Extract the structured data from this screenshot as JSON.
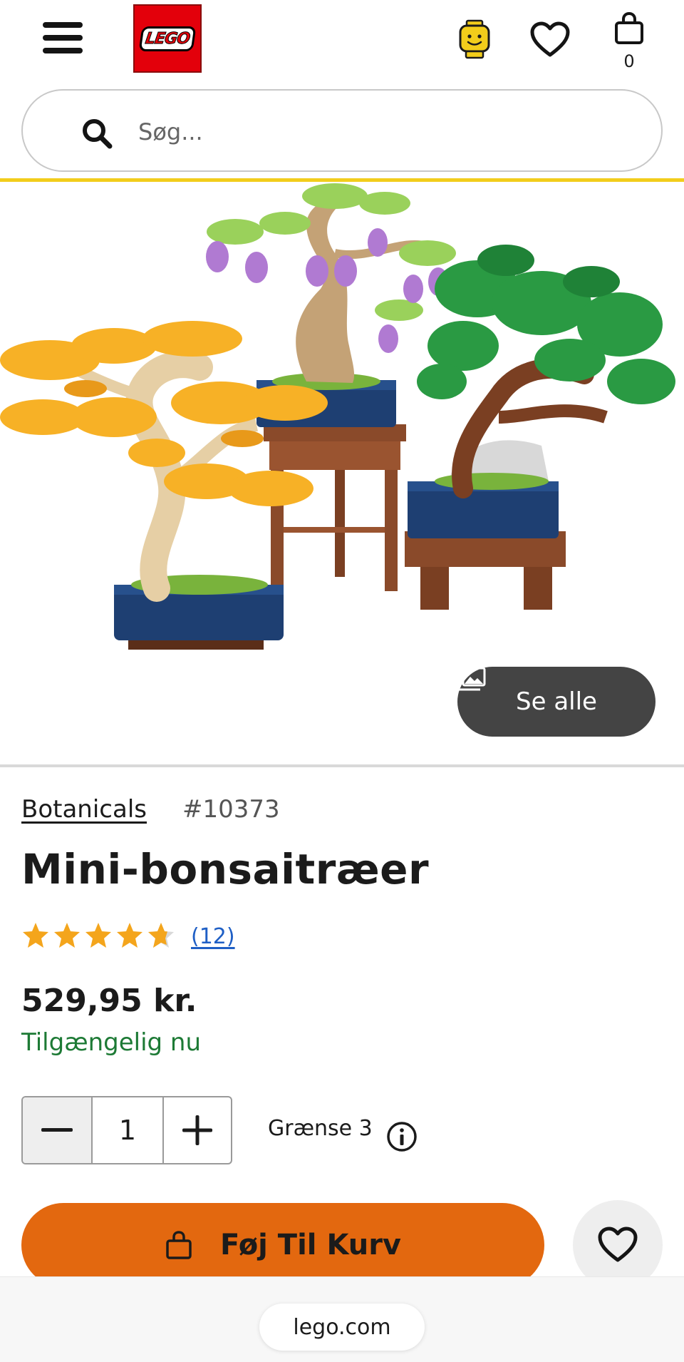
{
  "header": {
    "logo_text": "LEGO",
    "bag_count": "0"
  },
  "search": {
    "placeholder": "Søg..."
  },
  "gallery": {
    "see_all_label": "Se alle"
  },
  "product": {
    "theme": "Botanicals",
    "item_number": "#10373",
    "title": "Mini-bonsaitræer",
    "rating": 4.5,
    "rating_max": 5,
    "review_count": "(12)",
    "price": "529,95 kr.",
    "availability": "Tilgængelig nu"
  },
  "quantity": {
    "value": "1",
    "limit_label": "Grænse 3"
  },
  "cta": {
    "add_to_bag_label": "Føj Til Kurv"
  },
  "browser": {
    "url": "lego.com"
  },
  "colors": {
    "accent_yellow": "#f2cd1b",
    "cta_orange": "#e3680f",
    "star_orange": "#f4a51c",
    "availability_green": "#1d7a35",
    "link_blue": "#1f5fc5"
  }
}
